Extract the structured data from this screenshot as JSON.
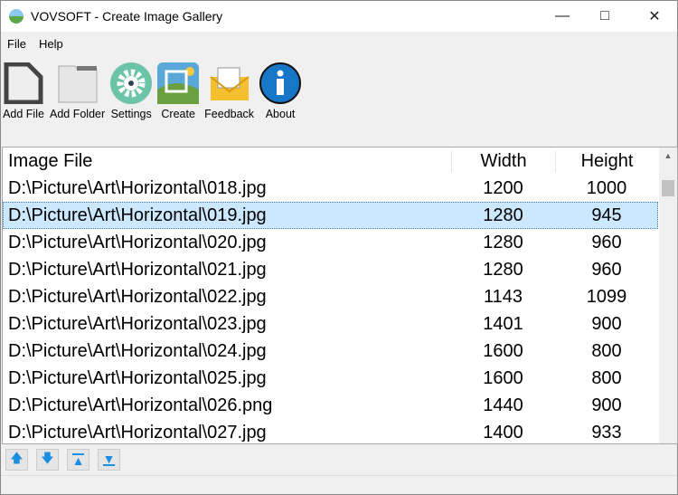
{
  "window": {
    "title": "VOVSOFT - Create Image Gallery"
  },
  "menu": [
    "File",
    "Help"
  ],
  "toolbar": [
    {
      "label": "Add File"
    },
    {
      "label": "Add Folder"
    },
    {
      "label": "Settings"
    },
    {
      "label": "Create"
    },
    {
      "label": "Feedback"
    },
    {
      "label": "About"
    }
  ],
  "table": {
    "headers": [
      "Image File",
      "Width",
      "Height"
    ],
    "rows": [
      [
        "D:\\Picture\\Art\\Horizontal\\018.jpg",
        "1200",
        "1000"
      ],
      [
        "D:\\Picture\\Art\\Horizontal\\019.jpg",
        "1280",
        "945"
      ],
      [
        "D:\\Picture\\Art\\Horizontal\\020.jpg",
        "1280",
        "960"
      ],
      [
        "D:\\Picture\\Art\\Horizontal\\021.jpg",
        "1280",
        "960"
      ],
      [
        "D:\\Picture\\Art\\Horizontal\\022.jpg",
        "1143",
        "1099"
      ],
      [
        "D:\\Picture\\Art\\Horizontal\\023.jpg",
        "1401",
        "900"
      ],
      [
        "D:\\Picture\\Art\\Horizontal\\024.jpg",
        "1600",
        "800"
      ],
      [
        "D:\\Picture\\Art\\Horizontal\\025.jpg",
        "1600",
        "800"
      ],
      [
        "D:\\Picture\\Art\\Horizontal\\026.png",
        "1440",
        "900"
      ],
      [
        "D:\\Picture\\Art\\Horizontal\\027.jpg",
        "1400",
        "933"
      ]
    ],
    "selected_row": 1
  }
}
